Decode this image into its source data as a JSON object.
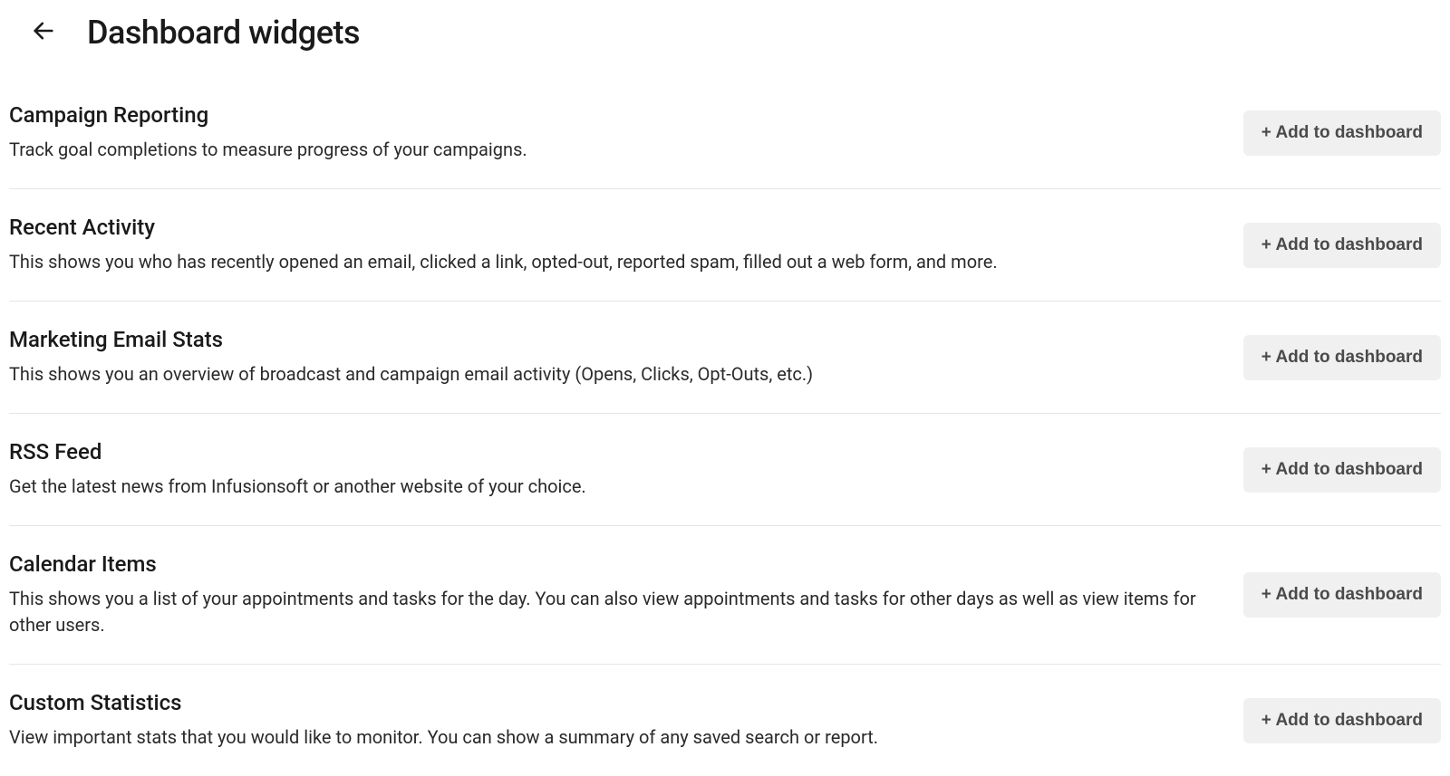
{
  "header": {
    "title": "Dashboard widgets"
  },
  "add_button_label": "+ Add to dashboard",
  "widgets": [
    {
      "title": "Campaign Reporting",
      "description": "Track goal completions to measure progress of your campaigns."
    },
    {
      "title": "Recent Activity",
      "description": "This shows you who has recently opened an email, clicked a link, opted-out, reported spam, filled out a web form, and more."
    },
    {
      "title": "Marketing Email Stats",
      "description": "This shows you an overview of broadcast and campaign email activity (Opens, Clicks, Opt-Outs, etc.)"
    },
    {
      "title": "RSS Feed",
      "description": "Get the latest news from Infusionsoft or another website of your choice."
    },
    {
      "title": "Calendar Items",
      "description": "This shows you a list of your appointments and tasks for the day. You can also view appointments and tasks for other days as well as view items for other users."
    },
    {
      "title": "Custom Statistics",
      "description": "View important stats that you would like to monitor. You can show a summary of any saved search or report."
    }
  ]
}
